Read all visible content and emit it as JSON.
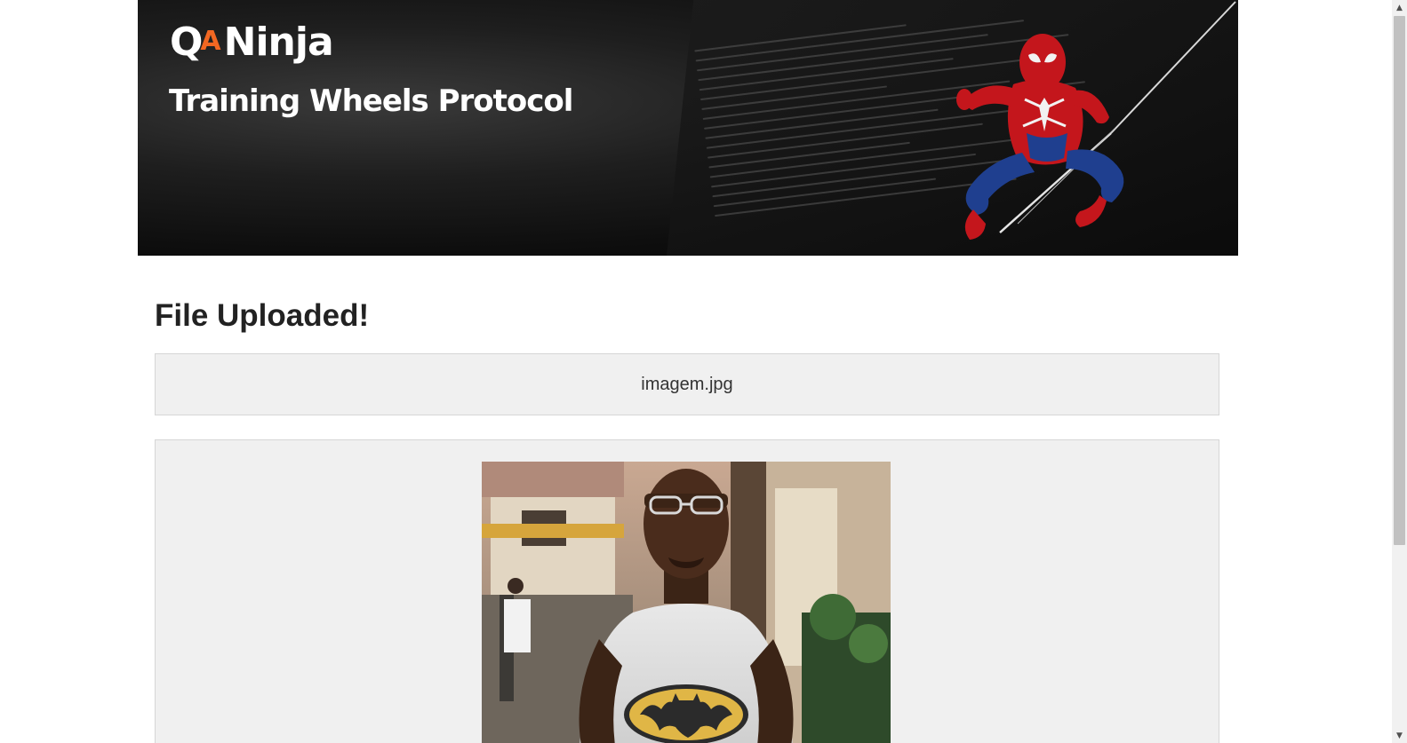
{
  "header": {
    "logo_q": "Q",
    "logo_a": "A",
    "logo_ninja": "Ninja",
    "tagline": "Training Wheels Protocol",
    "hero_image": "spider-man-illustration"
  },
  "main": {
    "title": "File Uploaded!",
    "file_name": "imagem.jpg",
    "preview_image": "uploaded-photo-preview"
  },
  "scrollbar": {
    "up_icon": "▲",
    "down_icon": "▼"
  },
  "colors": {
    "logo_accent": "#f26722",
    "banner_bg": "#0d0d0d",
    "panel_bg": "#f0f0f0",
    "panel_border": "#d6d6d6",
    "title_text": "#222222"
  }
}
